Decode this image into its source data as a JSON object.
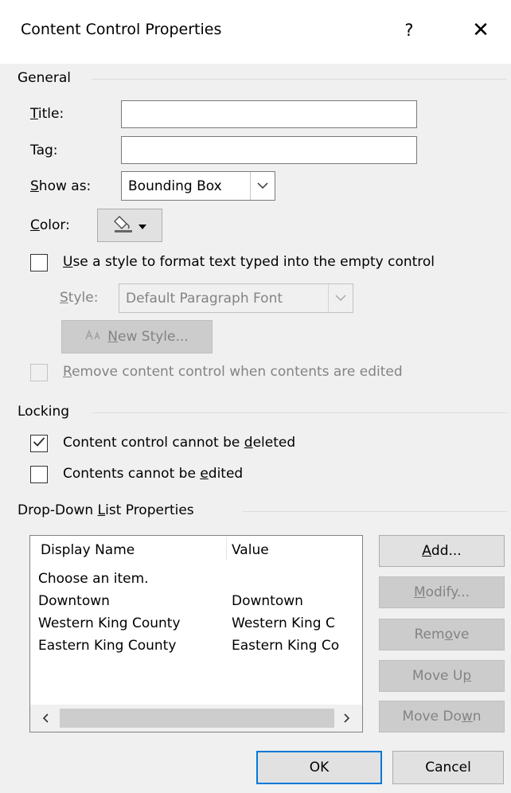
{
  "dialog": {
    "title": "Content Control Properties",
    "help_label": "?",
    "close_label": "✕"
  },
  "general": {
    "heading": "General",
    "title_label": {
      "pre": "",
      "key": "T",
      "post": "itle:"
    },
    "title_value": "",
    "tag_label": {
      "pre": "Ta",
      "key": "g",
      "post": ":"
    },
    "tag_value": "",
    "show_as_label": {
      "pre": "",
      "key": "S",
      "post": "how as:"
    },
    "show_as_value": "Bounding Box",
    "color_label": {
      "pre": "",
      "key": "C",
      "post": "olor:"
    },
    "use_style_label": {
      "pre": "",
      "key": "U",
      "post": "se a style to format text typed into the empty control"
    },
    "use_style_checked": false,
    "style_label": {
      "pre": "",
      "key": "S",
      "post": "tyle:"
    },
    "style_value": "Default Paragraph Font",
    "new_style_label": {
      "pre": "",
      "key": "N",
      "post": "ew Style..."
    },
    "remove_cc_label": {
      "pre": "",
      "key": "R",
      "post": "emove content control when contents are edited"
    },
    "remove_cc_checked": false
  },
  "locking": {
    "heading": "Locking",
    "cannot_delete_label": {
      "pre": "Content control cannot be ",
      "key": "d",
      "post": "eleted"
    },
    "cannot_delete_checked": true,
    "cannot_edit_label": {
      "pre": "Contents cannot be ",
      "key": "e",
      "post": "dited"
    },
    "cannot_edit_checked": false
  },
  "dropdown": {
    "heading": {
      "pre": "Drop-Down ",
      "key": "L",
      "post": "ist Properties"
    },
    "columns": [
      "Display Name",
      "Value"
    ],
    "rows": [
      {
        "display": "Choose an item.",
        "value": ""
      },
      {
        "display": "Downtown",
        "value": "Downtown"
      },
      {
        "display": "Western King County",
        "value": "Western King C"
      },
      {
        "display": "Eastern King County",
        "value": "Eastern King Co"
      }
    ],
    "add_label": {
      "pre": "",
      "key": "A",
      "post": "dd..."
    },
    "modify_label": {
      "pre": "",
      "key": "M",
      "post": "odify..."
    },
    "remove_label": {
      "pre": "Rem",
      "key": "o",
      "post": "ve"
    },
    "move_up_label": {
      "pre": "Move U",
      "key": "p",
      "post": ""
    },
    "move_down_label": {
      "pre": "Move Do",
      "key": "w",
      "post": "n"
    }
  },
  "footer": {
    "ok_label": "OK",
    "cancel_label": "Cancel"
  },
  "colors": {
    "dialog_bg": "#f0f0f0",
    "default_button_border": "#0078d7",
    "disabled_text": "#838383"
  },
  "icons": {
    "help": "question-icon",
    "close": "close-icon",
    "color_picker": "paint-bucket-icon",
    "new_style": "style-icon"
  }
}
